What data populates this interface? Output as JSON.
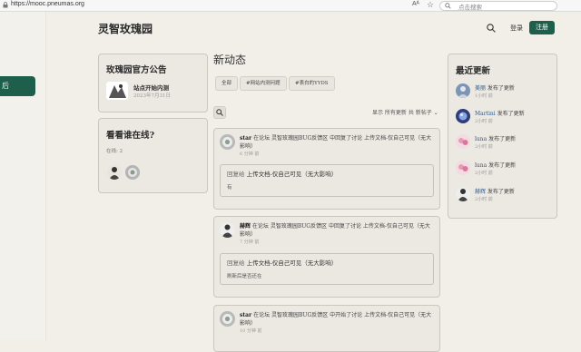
{
  "browser": {
    "url": "https://mooc.pneumas.org",
    "read_aloud": "Aᴬ",
    "favorite": "☆",
    "search_placeholder": "点击搜索"
  },
  "sidebar": {
    "button_label": "后"
  },
  "header": {
    "brand": "灵智玫瑰园",
    "login": "登录",
    "register": "注册"
  },
  "announcement": {
    "title": "玫瑰园官方公告",
    "item_name": "站点开始内测",
    "item_date": "2023年7月31日"
  },
  "online": {
    "title": "看看谁在线?",
    "count": "在线: 2"
  },
  "feed": {
    "title": "新动态",
    "chips": [
      "全部",
      "#网站内测问题",
      "#表白的YYDS"
    ],
    "filter": "显示 所有更新  共 新帖子 ⌄",
    "posts": [
      {
        "author": "star",
        "action": " 在论坛 灵智玫瑰园BUG反馈区 中回复了讨论 上传文档-仅自己可见（无大影响）",
        "time": "6 分钟 前",
        "reply_label": "回复给 ",
        "reply_title": "上传文档-仅自己可见（无大影响）",
        "reply_body": "有"
      },
      {
        "author": "赫辉",
        "action": " 在论坛 灵智玫瑰园BUG反馈区 中回复了讨论 上传文档-仅自己可见（无大影响）",
        "time": "7 分钟 前",
        "reply_label": "回复给 ",
        "reply_title": "上传文档-仅自己可见（无大影响）",
        "reply_body": "刷新后是否还在"
      },
      {
        "author": "star",
        "action": " 在论坛 灵智玫瑰园BUG反馈区 中开始了讨论 上传文档-仅自己可见（无大影响）",
        "time": "10 分钟 前"
      }
    ]
  },
  "recent": {
    "title": "最近更新",
    "verb": " 发布了更新",
    "items": [
      {
        "name": "美丽",
        "time": "1小时 前"
      },
      {
        "name": "Martini",
        "time": "2小时 前"
      },
      {
        "name": "luna",
        "time": "2小时 前"
      },
      {
        "name": "luna",
        "time": "2小时 前"
      },
      {
        "name": "赫辉",
        "time": "2小时 前"
      }
    ]
  },
  "colors": {
    "accent": "#1e5f4c",
    "background": "#f2efe9",
    "card": "#ece8e2",
    "link": "#2d5a8a"
  }
}
